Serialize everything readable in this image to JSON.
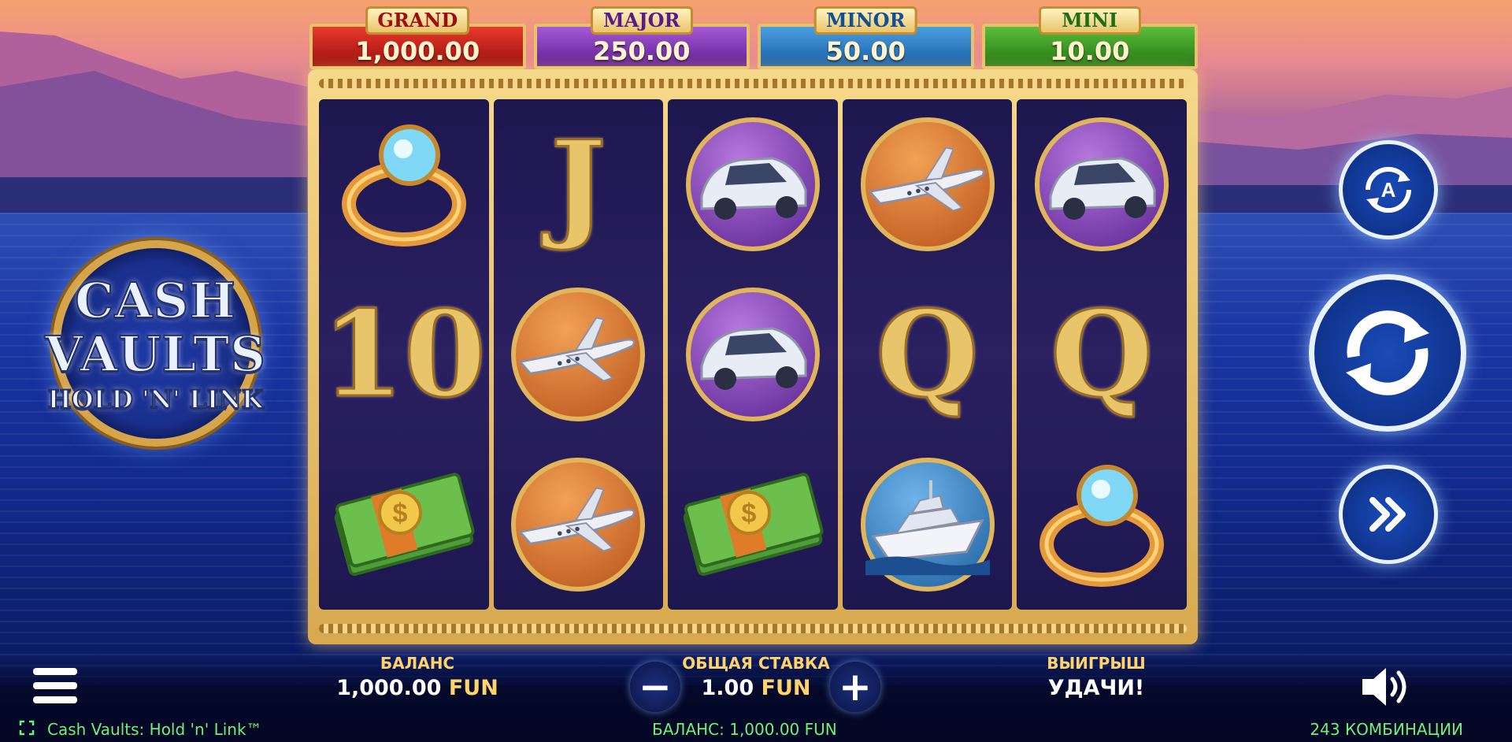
{
  "game": {
    "logo": {
      "line1": "CASH",
      "line2": "VAULTS",
      "line3": "HOLD 'N' LINK"
    }
  },
  "jackpots": [
    {
      "label": "GRAND",
      "value": "1,000.00"
    },
    {
      "label": "MAJOR",
      "value": "250.00"
    },
    {
      "label": "MINOR",
      "value": "50.00"
    },
    {
      "label": "MINI",
      "value": "10.00"
    }
  ],
  "reels": [
    [
      "ring",
      "10",
      "cash"
    ],
    [
      "J",
      "jet",
      "jet"
    ],
    [
      "car",
      "car",
      "cash"
    ],
    [
      "jet",
      "Q",
      "yacht"
    ],
    [
      "car",
      "Q",
      "ring"
    ]
  ],
  "controls": {
    "autoplay_icon": "autoplay-icon",
    "spin_icon": "spin-icon",
    "turbo_icon": "fast-forward-icon",
    "menu_icon": "hamburger-menu-icon",
    "sound_icon": "speaker-icon",
    "minus": "−",
    "plus": "+"
  },
  "balance": {
    "label": "БАЛАНС",
    "amount": "1,000.00",
    "currency": "FUN"
  },
  "bet": {
    "label": "ОБЩАЯ СТАВКА",
    "amount": "1.00",
    "currency": "FUN"
  },
  "win": {
    "label": "ВЫИГРЫШ",
    "text": "УДАЧИ!"
  },
  "footer": {
    "title": "Cash Vaults: Hold 'n' Link™",
    "balance": "БАЛАНС: 1,000.00 FUN",
    "ways": "243 КОМБИНАЦИИ"
  },
  "colors": {
    "accent_gold": "#ffd36a",
    "footer_green": "#6ef07a"
  }
}
